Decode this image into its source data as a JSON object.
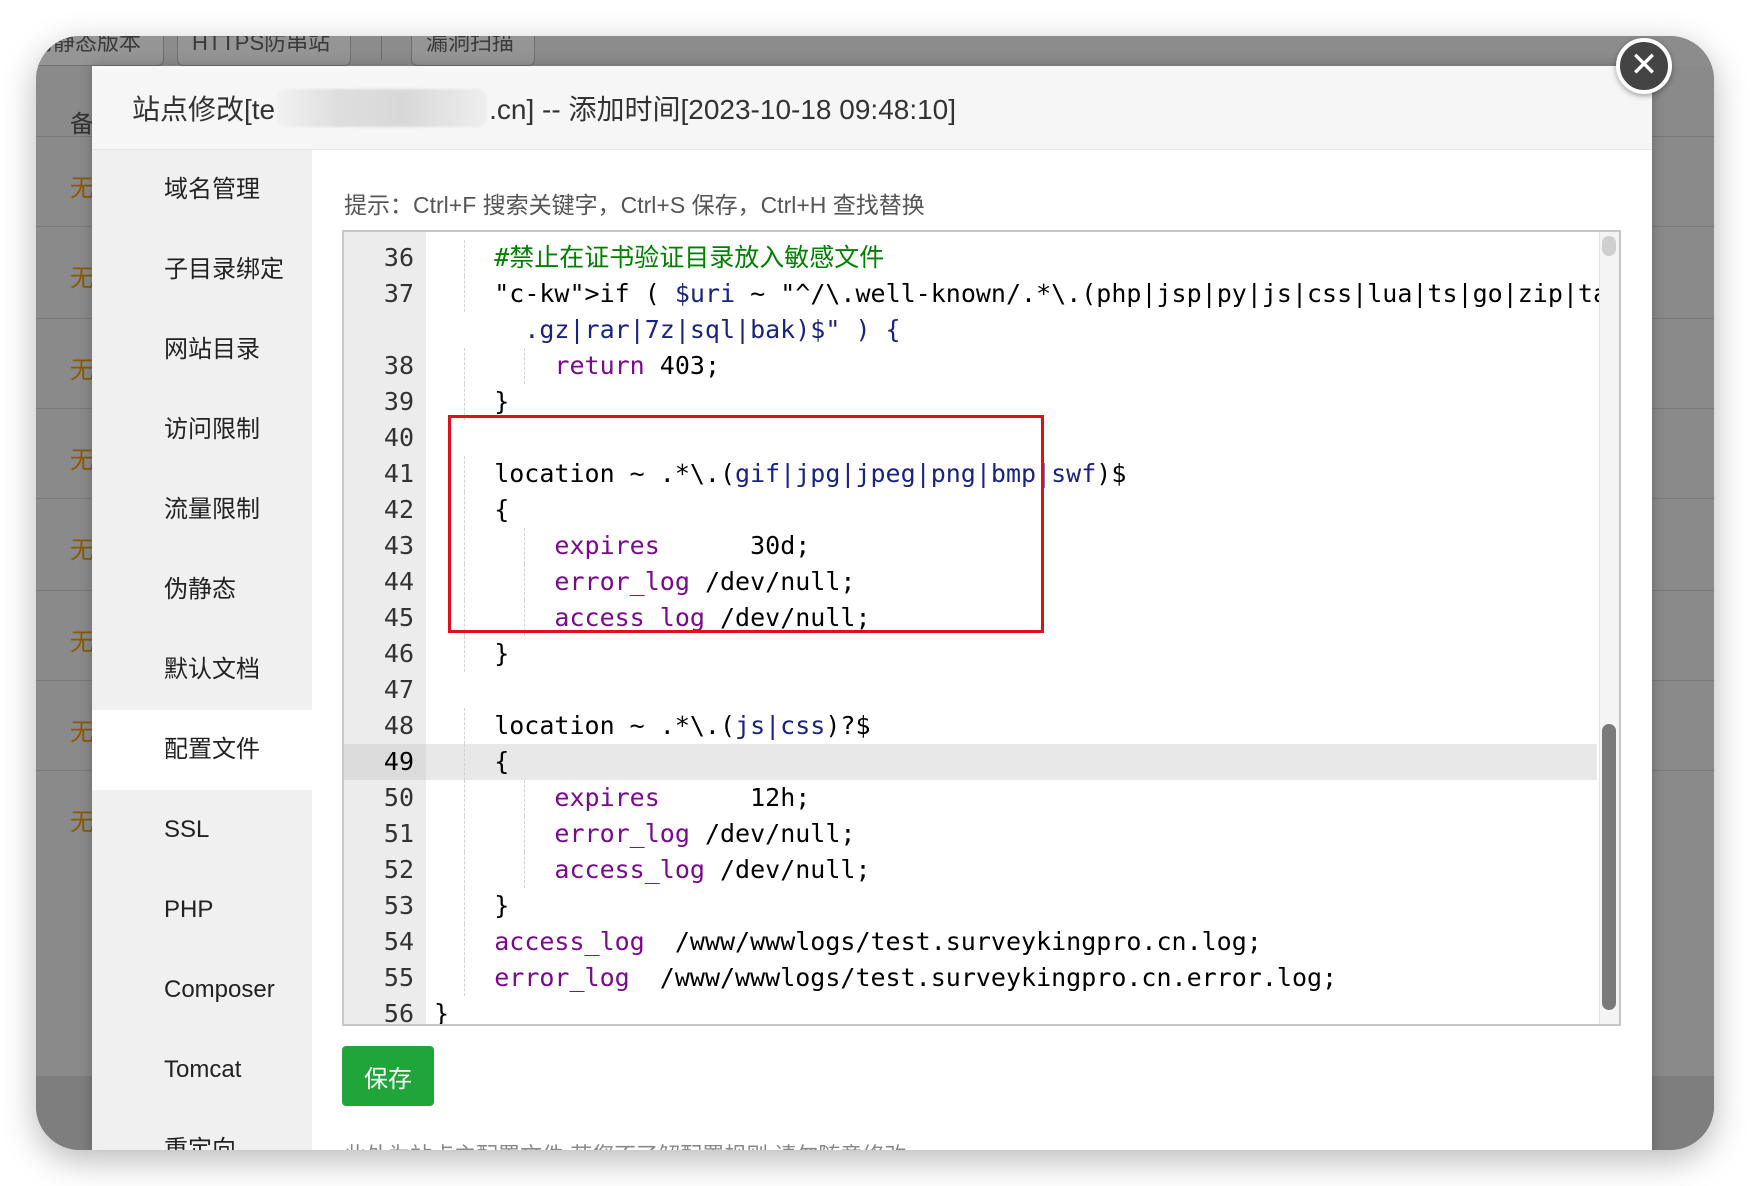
{
  "background": {
    "tabs": [
      "伪静态版本",
      "HTTPS防串站",
      "漏洞扫描"
    ],
    "header_text": "备",
    "row_marks": [
      "无",
      "无",
      "无",
      "无",
      "无",
      "无",
      "无",
      "无"
    ]
  },
  "modal": {
    "title_prefix": "站点修改[te",
    "title_suffix": ".cn] -- 添加时间[2023-10-18 09:48:10]",
    "close_symbol": "✕"
  },
  "sidebar": {
    "items": [
      {
        "label": "域名管理"
      },
      {
        "label": "子目录绑定"
      },
      {
        "label": "网站目录"
      },
      {
        "label": "访问限制"
      },
      {
        "label": "流量限制"
      },
      {
        "label": "伪静态"
      },
      {
        "label": "默认文档"
      },
      {
        "label": "配置文件"
      },
      {
        "label": "SSL"
      },
      {
        "label": "PHP"
      },
      {
        "label": "Composer"
      },
      {
        "label": "Tomcat"
      },
      {
        "label": "重定向"
      }
    ],
    "active_index": 7
  },
  "content": {
    "hint": "提示：Ctrl+F 搜索关键字，Ctrl+S 保存，Ctrl+H 查找替换",
    "save_label": "保存",
    "bottom_note": "此处为站点主配置文件,若您不了解配置规则,请勿随意修改."
  },
  "editor": {
    "lines": [
      {
        "n": "36",
        "text": "    #禁止在证书验证目录放入敏感文件"
      },
      {
        "n": "37",
        "text": "    if ( $uri ~ \"^/\\.well-known/.*\\.(php|jsp|py|js|css|lua|ts|go|zip|tar\\"
      },
      {
        "n": "",
        "text": "      .gz|rar|7z|sql|bak)$\" ) {"
      },
      {
        "n": "38",
        "text": "        return 403;"
      },
      {
        "n": "39",
        "text": "    }"
      },
      {
        "n": "40",
        "text": ""
      },
      {
        "n": "41",
        "text": "    location ~ .*\\.(gif|jpg|jpeg|png|bmp|swf)$"
      },
      {
        "n": "42",
        "text": "    {"
      },
      {
        "n": "43",
        "text": "        expires      30d;"
      },
      {
        "n": "44",
        "text": "        error_log /dev/null;"
      },
      {
        "n": "45",
        "text": "        access_log /dev/null;"
      },
      {
        "n": "46",
        "text": "    }"
      },
      {
        "n": "47",
        "text": ""
      },
      {
        "n": "48",
        "text": "    location ~ .*\\.(js|css)?$"
      },
      {
        "n": "49",
        "text": "    {"
      },
      {
        "n": "50",
        "text": "        expires      12h;"
      },
      {
        "n": "51",
        "text": "        error_log /dev/null;"
      },
      {
        "n": "52",
        "text": "        access_log /dev/null;"
      },
      {
        "n": "53",
        "text": "    }"
      },
      {
        "n": "54",
        "text": "    access_log  /www/wwwlogs/test.surveykingpro.cn.log;"
      },
      {
        "n": "55",
        "text": "    error_log  /www/wwwlogs/test.surveykingpro.cn.error.log;"
      },
      {
        "n": "56",
        "text": "}"
      }
    ],
    "current_line": "49"
  },
  "colors": {
    "save_button": "#20a53a",
    "highlight_box": "#e0101a",
    "comment": "#008000",
    "keyword": "#7a0a8c"
  }
}
